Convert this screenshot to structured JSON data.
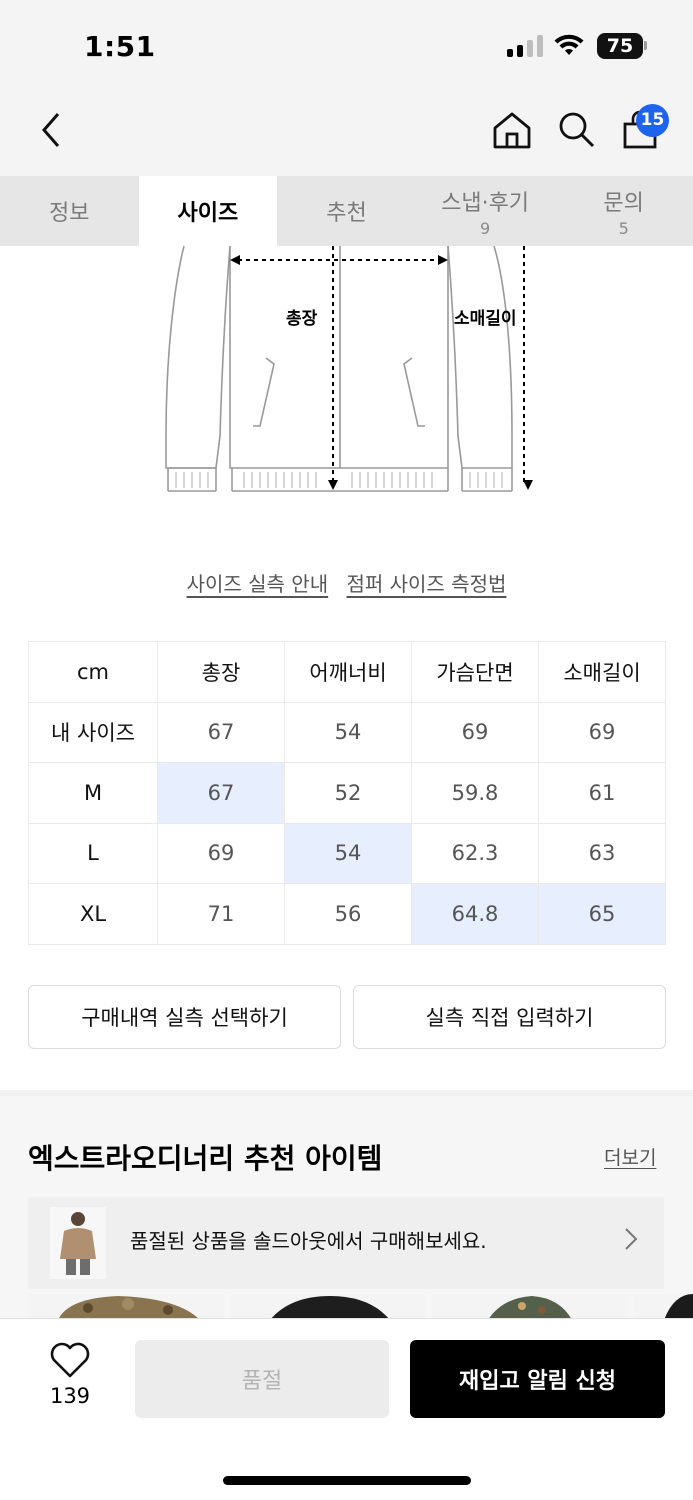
{
  "status": {
    "time": "1:51",
    "battery": "75"
  },
  "header": {
    "cart_count": "15"
  },
  "tabs": [
    {
      "label": "정보",
      "count": ""
    },
    {
      "label": "사이즈",
      "count": ""
    },
    {
      "label": "추천",
      "count": ""
    },
    {
      "label": "스냅·후기",
      "count": "9"
    },
    {
      "label": "문의",
      "count": "5"
    }
  ],
  "diagram": {
    "label_length": "총장",
    "label_sleeve": "소매길이"
  },
  "guide_links": {
    "size_guide": "사이즈 실측 안내",
    "measure_method": "점퍼 사이즈 측정법"
  },
  "size_table": {
    "headers": [
      "cm",
      "총장",
      "어깨너비",
      "가슴단면",
      "소매길이"
    ],
    "rows": [
      {
        "label": "내 사이즈",
        "values": [
          "67",
          "54",
          "69",
          "69"
        ]
      },
      {
        "label": "M",
        "values": [
          "67",
          "52",
          "59.8",
          "61"
        ]
      },
      {
        "label": "L",
        "values": [
          "69",
          "54",
          "62.3",
          "63"
        ]
      },
      {
        "label": "XL",
        "values": [
          "71",
          "56",
          "64.8",
          "65"
        ]
      }
    ]
  },
  "buttons": {
    "purchase_history": "구매내역 실측 선택하기",
    "direct_input": "실측 직접 입력하기"
  },
  "recommend": {
    "title": "엑스트라오디너리 추천 아이템",
    "more": "더보기",
    "banner_text": "품절된 상품을 솔드아웃에서 구매해보세요."
  },
  "bottom": {
    "like_count": "139",
    "soldout": "품절",
    "restock": "재입고 알림 신청"
  }
}
